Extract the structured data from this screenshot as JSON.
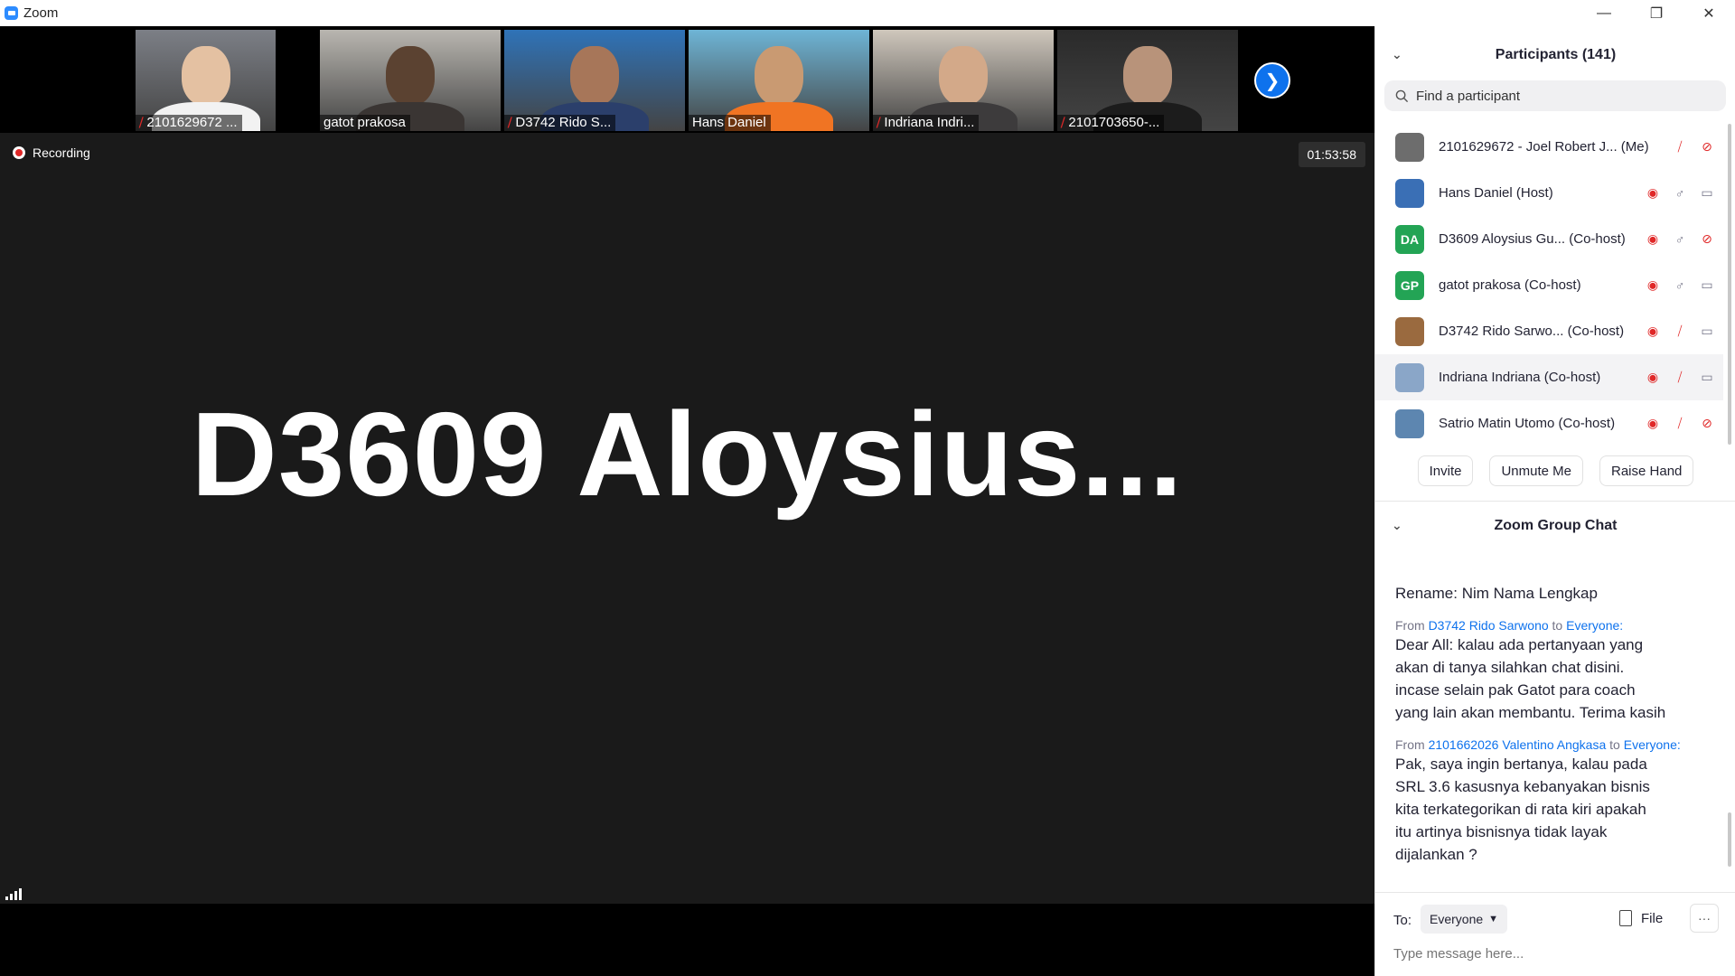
{
  "window": {
    "title": "Zoom"
  },
  "thumbnails": [
    {
      "name": "2101629672 ...",
      "muted": true,
      "bg": "#7c7f86",
      "face": "#e4c1a2",
      "shirt": "#f2f2f2"
    },
    {
      "name": "gatot prakosa",
      "muted": false,
      "bg": "#b9b6b0",
      "face": "#5b4231",
      "shirt": "#3a3533"
    },
    {
      "name": "D3742 Rido S...",
      "muted": true,
      "bg": "#2f73b8",
      "face": "#a77659",
      "shirt": "#2b3f6b"
    },
    {
      "name": "Hans Daniel",
      "muted": false,
      "bg": "#6eb5d6",
      "face": "#c99a72",
      "shirt": "#f07423"
    },
    {
      "name": "Indriana Indri...",
      "muted": true,
      "bg": "#cfc7bc",
      "face": "#d3a989",
      "shirt": "#3d3b3c"
    },
    {
      "name": "2101703650-...",
      "muted": true,
      "bg": "#2a2a2a",
      "face": "#b8937a",
      "shirt": "#1c1c1c"
    }
  ],
  "stage": {
    "recording_label": "Recording",
    "timer": "01:53:58",
    "active_speaker": "D3609  Aloysius..."
  },
  "participants": {
    "title": "Participants (141)",
    "search_placeholder": "Find a participant",
    "items": [
      {
        "name": "2101629672 - Joel Robert J...  (Me)",
        "initials": "",
        "avatar_color": "#6d6d6d",
        "spotlight": false,
        "mic": "muted",
        "video": "off"
      },
      {
        "name": "Hans Daniel (Host)",
        "initials": "",
        "avatar_color": "#3a6fb5",
        "spotlight": true,
        "mic": "on",
        "video": "on"
      },
      {
        "name": "D3609 Aloysius Gu... (Co-host)",
        "initials": "DA",
        "avatar_color": "#23a455",
        "spotlight": true,
        "mic": "on",
        "video": "off"
      },
      {
        "name": "gatot prakosa (Co-host)",
        "initials": "GP",
        "avatar_color": "#23a455",
        "spotlight": true,
        "mic": "on",
        "video": "on"
      },
      {
        "name": "D3742 Rido Sarwo... (Co-host)",
        "initials": "",
        "avatar_color": "#9a6a3f",
        "spotlight": true,
        "mic": "muted",
        "video": "on"
      },
      {
        "name": "Indriana Indriana (Co-host)",
        "initials": "",
        "avatar_color": "#8aa6c8",
        "spotlight": true,
        "mic": "muted",
        "video": "on"
      },
      {
        "name": "Satrio Matin Utomo (Co-host)",
        "initials": "",
        "avatar_color": "#5d86b0",
        "spotlight": true,
        "mic": "muted",
        "video": "off"
      }
    ],
    "buttons": {
      "invite": "Invite",
      "unmute": "Unmute Me",
      "raise_hand": "Raise Hand"
    }
  },
  "chat": {
    "title": "Zoom Group Chat",
    "messages": [
      {
        "from": "",
        "to": "",
        "lines": [
          "Rename: Nim Nama Lengkap"
        ]
      },
      {
        "from": "D3742 Rido Sarwono",
        "to": "Everyone:",
        "lines": [
          "Dear All: kalau ada pertanyaan yang",
          "akan di tanya silahkan chat disini.",
          "incase selain pak Gatot para coach",
          "yang lain akan membantu. Terima kasih"
        ]
      },
      {
        "from": "2101662026 Valentino Angkasa",
        "to": "Everyone:",
        "lines": [
          "Pak, saya ingin bertanya, kalau pada",
          "SRL 3.6 kasusnya kebanyakan bisnis",
          "kita terkategorikan di rata kiri apakah",
          "itu artinya bisnisnya tidak layak",
          "dijalankan ?"
        ]
      }
    ],
    "from_word": "From",
    "to_word": "to",
    "to_label": "To:",
    "to_value": "Everyone",
    "file_label": "File",
    "input_placeholder": "Type message here..."
  }
}
